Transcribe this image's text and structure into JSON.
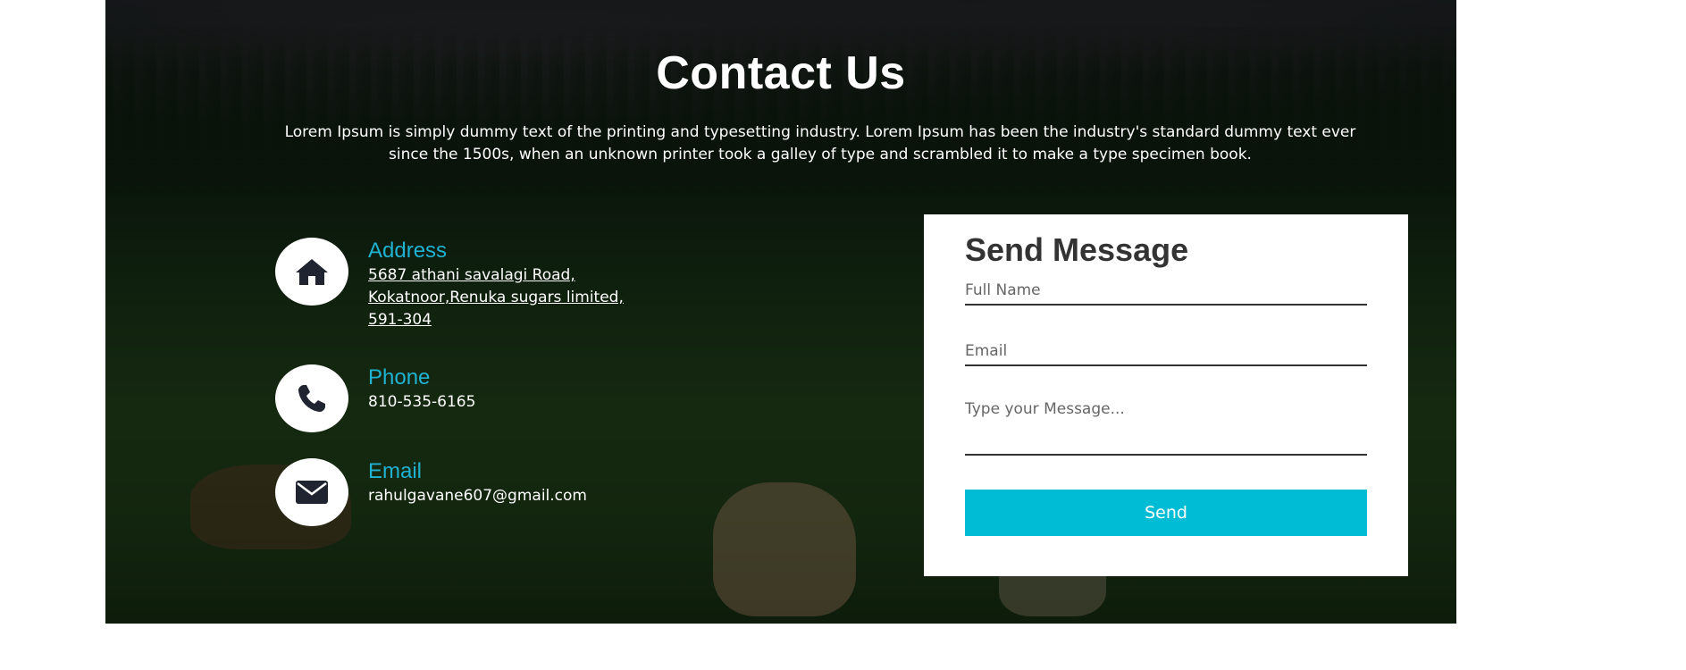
{
  "contact": {
    "heading": "Contact Us",
    "intro": "Lorem Ipsum is simply dummy text of the printing and typesetting industry. Lorem Ipsum has been the industry's standard dummy text ever since the 1500s, when an unknown printer took a galley of type and scrambled it to make a type specimen book."
  },
  "info": {
    "address": {
      "icon": "home-icon",
      "title": "Address",
      "lines": [
        "5687 athani savalagi Road,",
        "Kokatnoor,Renuka sugars limited,",
        "591-304"
      ]
    },
    "phone": {
      "icon": "phone-icon",
      "title": "Phone",
      "value": "810-535-6165"
    },
    "email": {
      "icon": "envelope-icon",
      "title": "Email",
      "value": "rahulgavane607@gmail.com"
    }
  },
  "form": {
    "title": "Send Message",
    "name_placeholder": "Full Name",
    "email_placeholder": "Email",
    "message_placeholder": "Type your Message...",
    "send_label": "Send"
  },
  "colors": {
    "accent": "#00bcd4",
    "info_title": "#1fb2d1",
    "icon": "#1f2430"
  }
}
